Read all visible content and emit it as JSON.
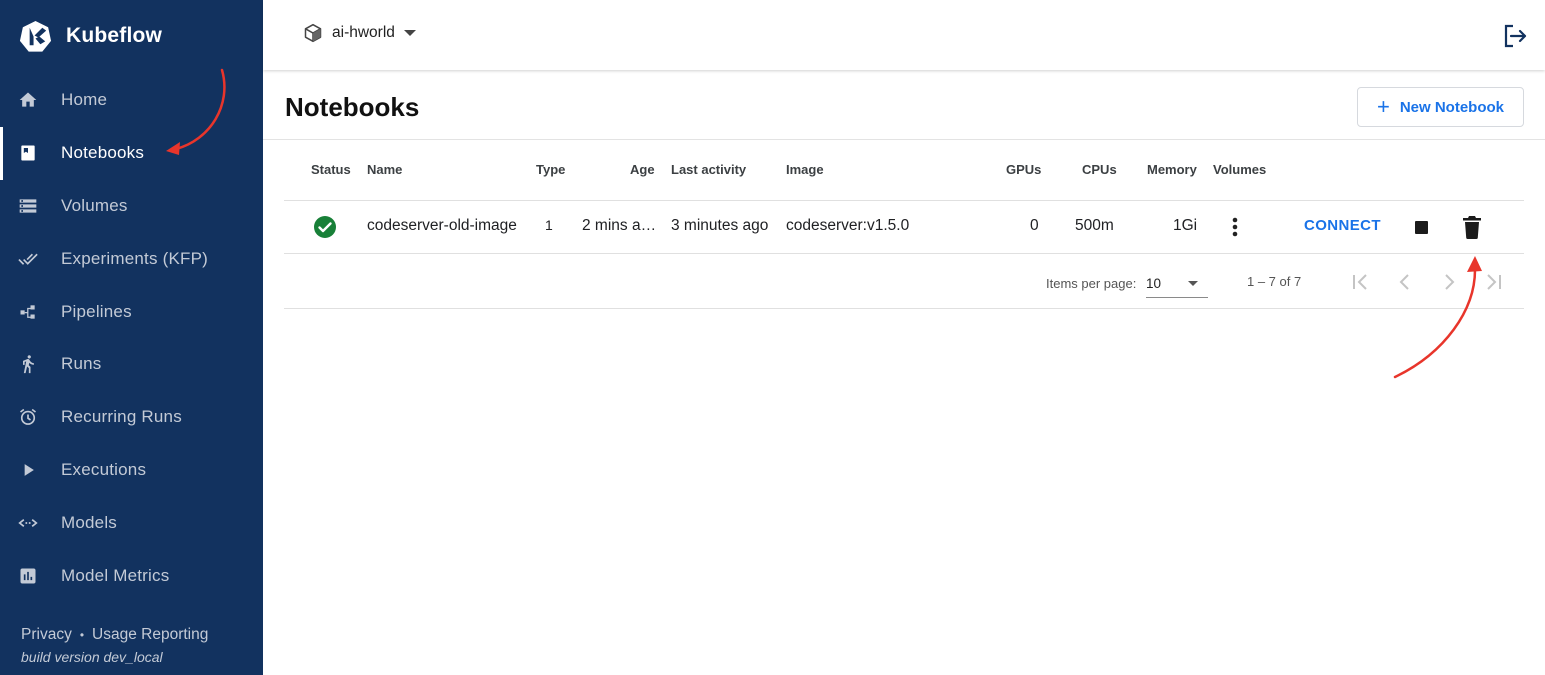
{
  "brand": {
    "name": "Kubeflow"
  },
  "sidebar": {
    "items": [
      {
        "label": "Home",
        "icon": "home-icon",
        "active": false
      },
      {
        "label": "Notebooks",
        "icon": "notebook-icon",
        "active": true
      },
      {
        "label": "Volumes",
        "icon": "storage-icon",
        "active": false
      },
      {
        "label": "Experiments (KFP)",
        "icon": "done-all-icon",
        "active": false
      },
      {
        "label": "Pipelines",
        "icon": "pipeline-icon",
        "active": false
      },
      {
        "label": "Runs",
        "icon": "run-icon",
        "active": false
      },
      {
        "label": "Recurring Runs",
        "icon": "alarm-icon",
        "active": false
      },
      {
        "label": "Executions",
        "icon": "play-icon",
        "active": false
      },
      {
        "label": "Models",
        "icon": "code-arrows-icon",
        "active": false
      },
      {
        "label": "Model Metrics",
        "icon": "bar-chart-icon",
        "active": false
      }
    ],
    "footer": {
      "privacy": "Privacy",
      "separator": "•",
      "usage": "Usage Reporting",
      "build": "build version dev_local"
    }
  },
  "topbar": {
    "namespace": "ai-hworld",
    "namespace_icon": "cube-icon",
    "logout_icon": "logout-icon"
  },
  "page": {
    "title": "Notebooks",
    "new_button": "New Notebook",
    "new_button_icon": "+"
  },
  "table": {
    "headers": {
      "status": "Status",
      "name": "Name",
      "type": "Type",
      "age": "Age",
      "last_activity": "Last activity",
      "image": "Image",
      "gpus": "GPUs",
      "cpus": "CPUs",
      "memory": "Memory",
      "volumes": "Volumes"
    },
    "rows": [
      {
        "status": "ready",
        "name": "codeserver-old-image",
        "type": "1",
        "age": "2 mins a…",
        "last_activity": "3 minutes ago",
        "image": "codeserver:v1.5.0",
        "gpus": "0",
        "cpus": "500m",
        "memory": "1Gi",
        "connect": "CONNECT"
      }
    ]
  },
  "pagination": {
    "items_per_page_label": "Items per page:",
    "page_size": "10",
    "range": "1 – 7 of 7"
  },
  "colors": {
    "sidebar": "#12325f",
    "accent": "#1a73e8",
    "success": "#188038",
    "annotation": "#e8352b"
  }
}
